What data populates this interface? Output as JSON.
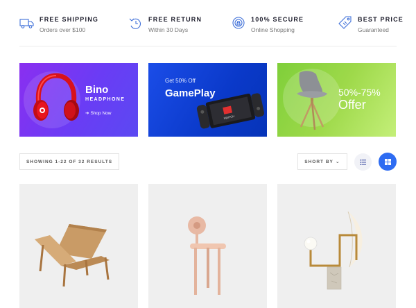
{
  "features": [
    {
      "icon": "truck-icon",
      "title": "FREE SHIPPING",
      "subtitle": "Orders over $100"
    },
    {
      "icon": "return-icon",
      "title": "FREE RETURN",
      "subtitle": "Within 30 Days"
    },
    {
      "icon": "secure-icon",
      "title": "100% SECURE",
      "subtitle": "Online Shopping"
    },
    {
      "icon": "price-tag-icon",
      "title": "BEST PRICE",
      "subtitle": "Guaranteed"
    }
  ],
  "banners": [
    {
      "title": "Bino",
      "subtitle": "HEADPHONE",
      "link": "Shop Now",
      "image": "red headphones"
    },
    {
      "small": "Get 50% Off",
      "title": "GamePlay",
      "image": "game console"
    },
    {
      "title": "50%-75%",
      "big": "Offer",
      "image": "grey chair"
    }
  ],
  "toolbar": {
    "results": "SHOWING 1-22 OF 32 RESULTS",
    "sort_label": "SHORT BY",
    "list_view_icon": "list-icon",
    "grid_view_icon": "grid-icon"
  },
  "products": [
    {
      "image": "wooden magazine rack"
    },
    {
      "image": "pink chair"
    },
    {
      "image": "brass lamp"
    }
  ],
  "colors": {
    "accent": "#2e6cf2",
    "icon_blue": "#3e6fd8",
    "banner1": "#7b35f2",
    "banner2": "#0a39c9",
    "banner3": "#9ed94a"
  }
}
